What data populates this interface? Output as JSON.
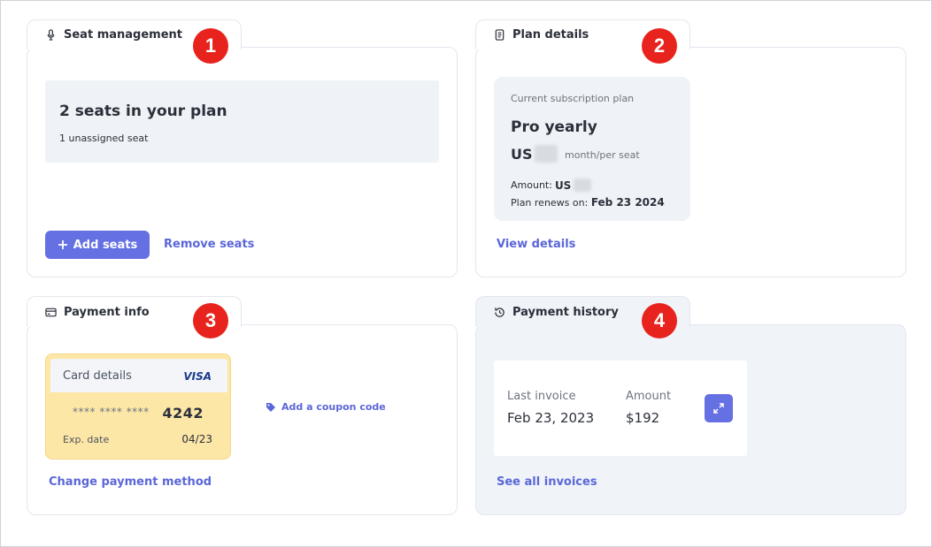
{
  "seat_management": {
    "tab_label": "Seat management",
    "icon": "microphone-icon",
    "badge": "1",
    "seats_title": "2 seats in your plan",
    "unassigned": "1 unassigned seat",
    "add_label": "Add seats",
    "remove_label": "Remove seats"
  },
  "plan_details": {
    "tab_label": "Plan details",
    "icon": "document-icon",
    "badge": "2",
    "current_label": "Current subscription plan",
    "plan_name": "Pro yearly",
    "currency": "US",
    "per_seat": "month/per seat",
    "amount_label": "Amount:",
    "amount_currency": "US",
    "renews_label": "Plan renews on:",
    "renews_date": "Feb 23 2024",
    "view_details": "View details"
  },
  "payment_info": {
    "tab_label": "Payment info",
    "icon": "credit-card-icon",
    "badge": "3",
    "card_details_label": "Card details",
    "card_brand": "VISA",
    "masked_number": "**** **** ****",
    "last4": "4242",
    "exp_label": "Exp. date",
    "exp_value": "04/23",
    "coupon_label": "Add a coupon code",
    "change_method": "Change payment method"
  },
  "payment_history": {
    "tab_label": "Payment history",
    "icon": "history-icon",
    "badge": "4",
    "last_invoice_label": "Last invoice",
    "last_invoice_date": "Feb 23, 2023",
    "amount_label": "Amount",
    "amount_value": "$192",
    "see_all": "See all invoices"
  },
  "colors": {
    "accent": "#6570e3",
    "link": "#5b67d8",
    "badge": "#e8231d",
    "card_yellow": "#fde7a7"
  }
}
